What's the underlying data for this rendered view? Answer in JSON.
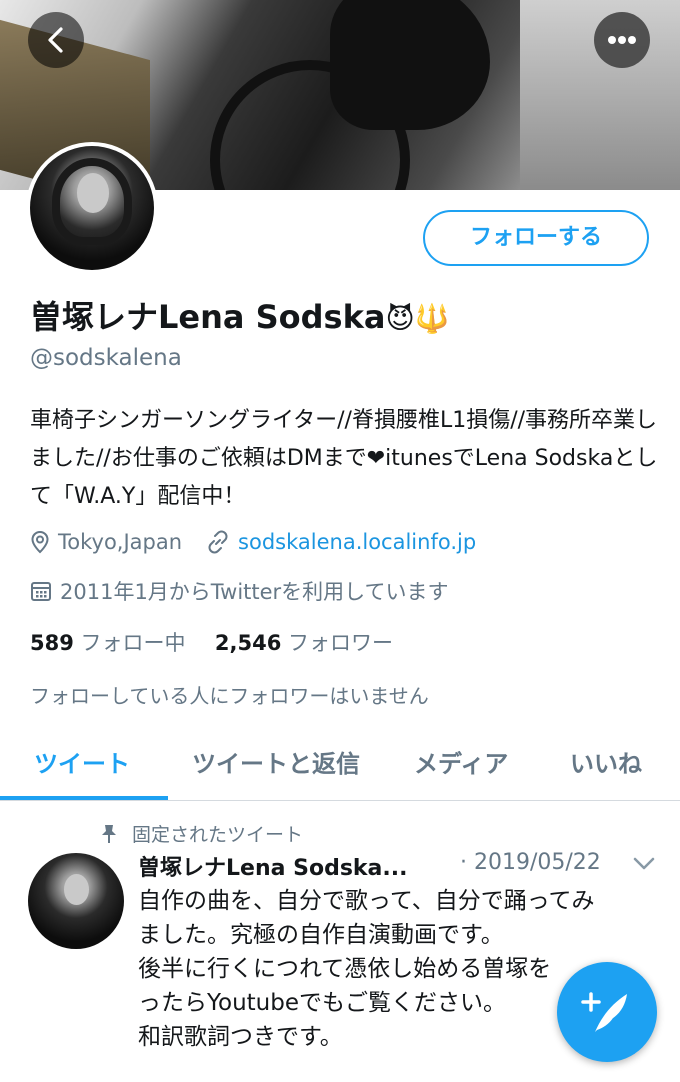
{
  "header": {
    "back_icon": "chevron-left-icon",
    "more_icon": "more-horizontal-icon"
  },
  "profile": {
    "follow_label": "フォローする",
    "name": "曽塚レナLena Sodska",
    "name_emoji": "😈🔱",
    "handle": "@sodskalena",
    "bio": "車椅子シンガーソングライター//脊損腰椎L1損傷//事務所卒業しました//お仕事のご依頼はDMまで❤itunesでLena Sodskaとして「W.A.Y」配信中！",
    "location": "Tokyo,Japan",
    "website": "sodskalena.localinfo.jp",
    "joined": "2011年1月からTwitterを利用しています",
    "following_count": "589",
    "following_label": "フォロー中",
    "followers_count": "2,546",
    "followers_label": "フォロワー",
    "followers_note": "フォローしている人にフォロワーはいません"
  },
  "tabs": [
    {
      "label": "ツイート"
    },
    {
      "label": "ツイートと返信"
    },
    {
      "label": "メディア"
    },
    {
      "label": "いいね"
    }
  ],
  "tweet": {
    "pinned_label": "固定されたツイート",
    "author": "曽塚レナLena Sodska...",
    "date": "· 2019/05/22",
    "text_lines": [
      "自作の曲を、自分で歌って、自分で踊ってみ",
      "ました。究極の自作自演動画です。",
      "後半に行くにつれて憑依し始める曽塚を",
      "ったらYoutubeでもご覧ください。",
      "和訳歌詞つきです。"
    ]
  },
  "colors": {
    "accent": "#1da1f2",
    "secondary_text": "#657786",
    "link": "#1b95e0"
  }
}
